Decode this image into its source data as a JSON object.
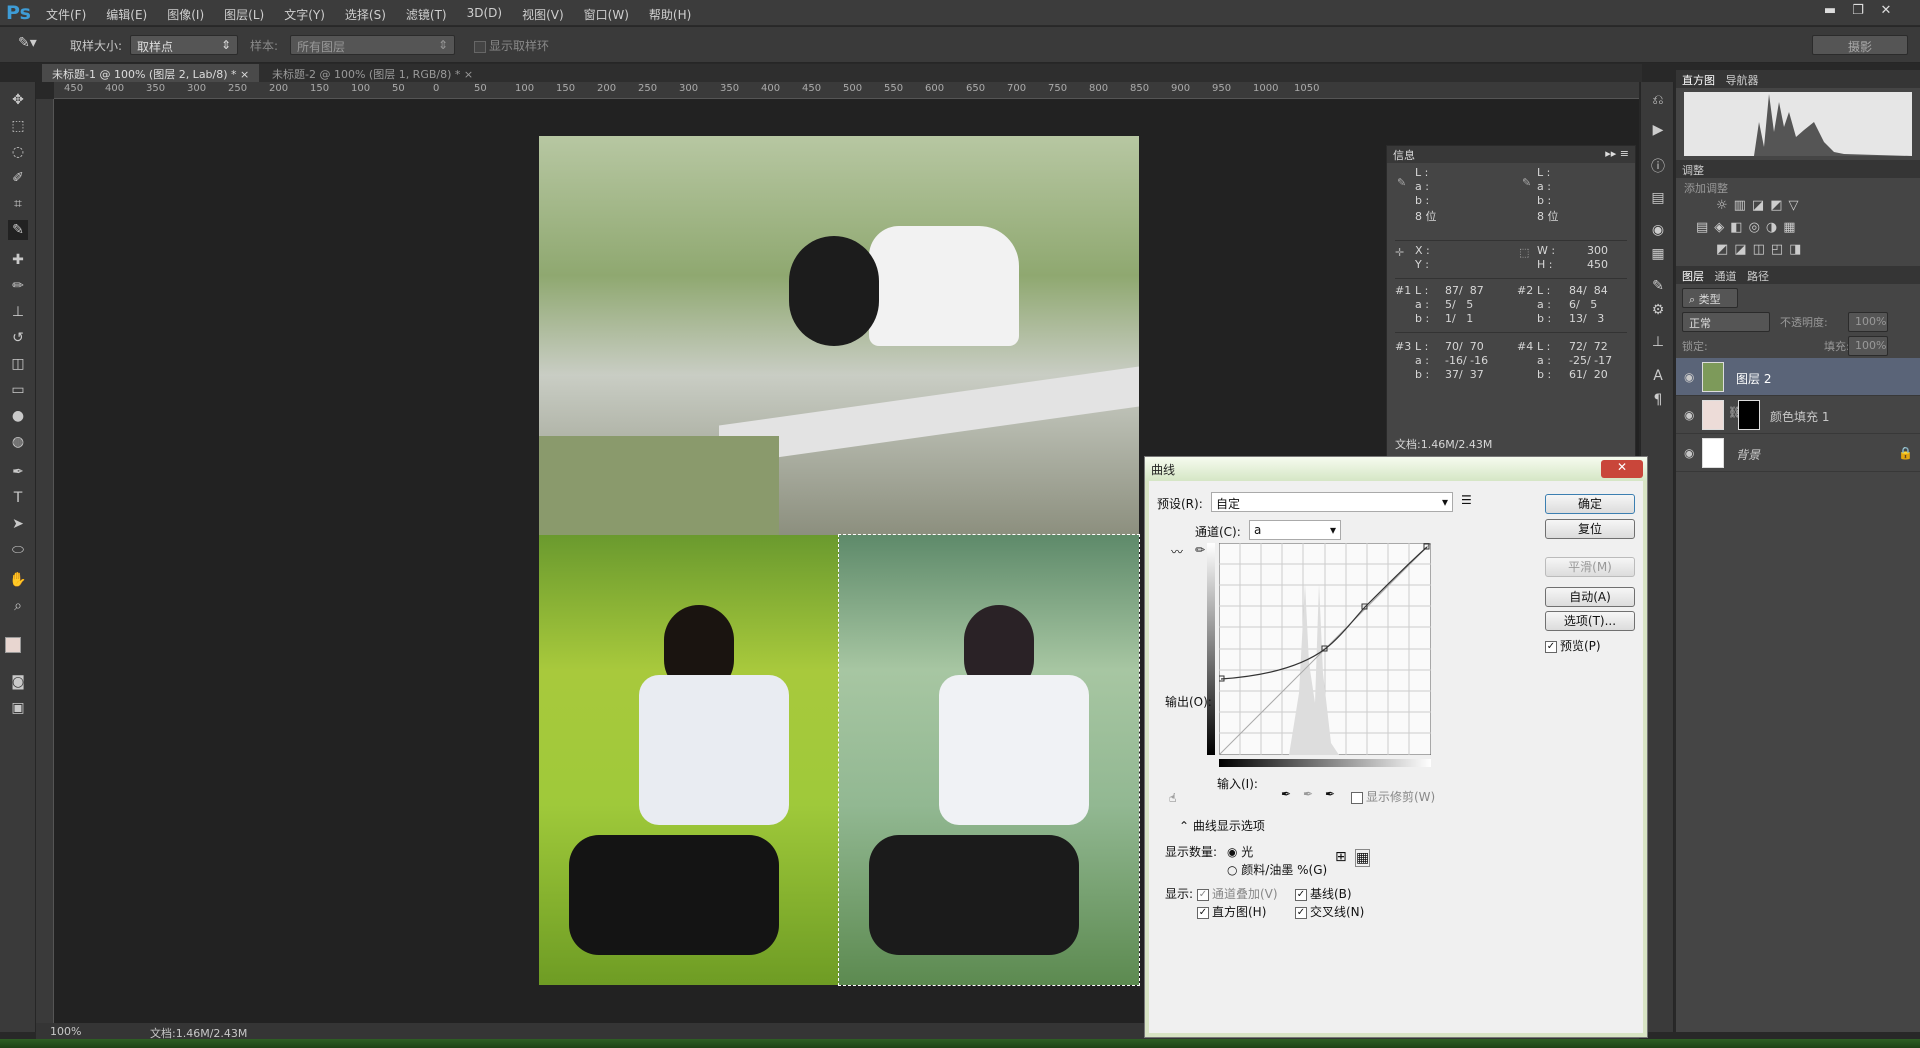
{
  "app": {
    "logo": "Ps",
    "menu": [
      "文件(F)",
      "编辑(E)",
      "图像(I)",
      "图层(L)",
      "文字(Y)",
      "选择(S)",
      "滤镜(T)",
      "3D(D)",
      "视图(V)",
      "窗口(W)",
      "帮助(H)"
    ]
  },
  "options": {
    "sample_size_label": "取样大小:",
    "sample_size_value": "取样点",
    "sample_label": "样本:",
    "sample_value": "所有图层",
    "show_ring": "显示取样环",
    "workspace": "摄影"
  },
  "tabs": [
    {
      "label": "未标题-1 @ 100% (图层 2, Lab/8) *"
    },
    {
      "label": "未标题-2 @ 100% (图层 1, RGB/8) *"
    }
  ],
  "ruler_ticks": [
    "450",
    "400",
    "350",
    "300",
    "250",
    "200",
    "150",
    "100",
    "50",
    "0",
    "50",
    "100",
    "150",
    "200",
    "250",
    "300",
    "350",
    "400",
    "450",
    "500",
    "550",
    "600",
    "650",
    "700",
    "750",
    "800",
    "850",
    "900",
    "950",
    "1000",
    "1050"
  ],
  "status": {
    "zoom": "100%",
    "doc": "文档:1.46M/2.43M"
  },
  "info": {
    "title": "信息",
    "lab1": "L :\na :\nb :",
    "bit1": "8 位",
    "lab2": "L :\na :\nb :",
    "bit2": "8 位",
    "xy": "X :\nY :",
    "wh": "W :\nH :",
    "wh_vals": "300\n450",
    "s1_label": "#1",
    "s1": "L :\na :\nb :",
    "s1_vals": "87/  87\n5/   5\n1/   1",
    "s2_label": "#2",
    "s2": "L :\na :\nb :",
    "s2_vals": "84/  84\n6/   5\n13/   3",
    "s3_label": "#3",
    "s3": "L :\na :\nb :",
    "s3_vals": "70/  70\n-16/ -16\n37/  37",
    "s4_label": "#4",
    "s4": "L :\na :\nb :",
    "s4_vals": "72/  72\n-25/ -17\n61/  20",
    "doc": "文档:1.46M/2.43M"
  },
  "right": {
    "tab_histogram": "直方图",
    "tab_navigator": "导航器",
    "adjust_title": "调整",
    "adjust_add": "添加调整",
    "tab_layers": "图层",
    "tab_channels": "通道",
    "tab_paths": "路径",
    "kind": "类型",
    "blend": "正常",
    "opacity_label": "不透明度:",
    "opacity": "100%",
    "lock_label": "锁定:",
    "fill_label": "填充:",
    "fill": "100%",
    "layers": [
      {
        "name": "图层 2"
      },
      {
        "name": "颜色填充 1"
      },
      {
        "name": "背景"
      }
    ]
  },
  "curves": {
    "title": "曲线",
    "preset_label": "预设(R):",
    "preset_value": "自定",
    "channel_label": "通道(C):",
    "channel_value": "a",
    "output_label": "输出(O):",
    "input_label": "输入(I):",
    "show_clipping": "显示修剪(W)",
    "ok": "确定",
    "reset": "复位",
    "smooth": "平滑(M)",
    "auto": "自动(A)",
    "options": "选项(T)...",
    "preview": "预览(P)",
    "display_options": "曲线显示选项",
    "show_amount": "显示数量:",
    "light": "光",
    "pigment": "颜料/油墨 %(G)",
    "show": "显示:",
    "channel_overlay": "通道叠加(V)",
    "baseline": "基线(B)",
    "histogram": "直方图(H)",
    "intersection": "交叉线(N)"
  }
}
